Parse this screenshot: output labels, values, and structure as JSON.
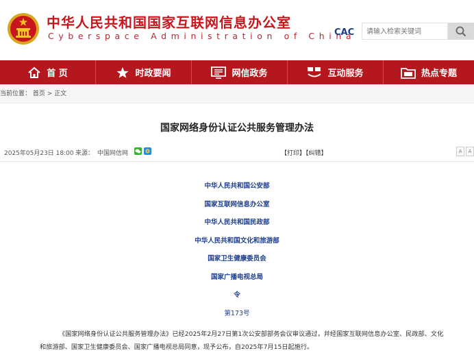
{
  "header": {
    "title": "中华人民共和国国家互联网信息办公室",
    "subtitle": "Cyberspace Administration of China",
    "cac_logo_text": "CAC",
    "search_placeholder": "请输入检索关键词"
  },
  "colors": {
    "brand_red": "#c8161d",
    "nav_red": "#b4181e",
    "link_blue": "#1e3e8c"
  },
  "nav": {
    "items": [
      {
        "label": "首 页",
        "icon": "home-icon"
      },
      {
        "label": "时政要闻",
        "icon": "star-icon"
      },
      {
        "label": "网信政务",
        "icon": "monitor-icon"
      },
      {
        "label": "互动服务",
        "icon": "interaction-icon"
      },
      {
        "label": "热点专题",
        "icon": "folder-icon"
      }
    ]
  },
  "breadcrumb": {
    "label": "当前位置：",
    "home": "首页",
    "separator": ">",
    "current": "正文"
  },
  "article": {
    "title": "国家网络身份认证公共服务管理办法",
    "date": "2025年05月23日 18:00",
    "source_label": "来源：",
    "source": "中国网信网",
    "print_links": "【打印】【纠错】",
    "font_larger": "A",
    "font_smaller": "A",
    "issuers": [
      "中华人民共和国公安部",
      "国家互联网信息办公室",
      "中华人民共和国民政部",
      "中华人民共和国文化和旅游部",
      "国家卫生健康委员会",
      "国家广播电视总局"
    ],
    "order": "令",
    "order_number": "第173号",
    "paragraph": "《国家网络身份认证公共服务管理办法》已经2025年2月27日第1次公安部部务会议审议通过，并经国家互联网信息办公室、民政部、文化和旅游部、国家卫生健康委员会、国家广播电视总局同意，现予公布，自2025年7月15日起施行。"
  }
}
